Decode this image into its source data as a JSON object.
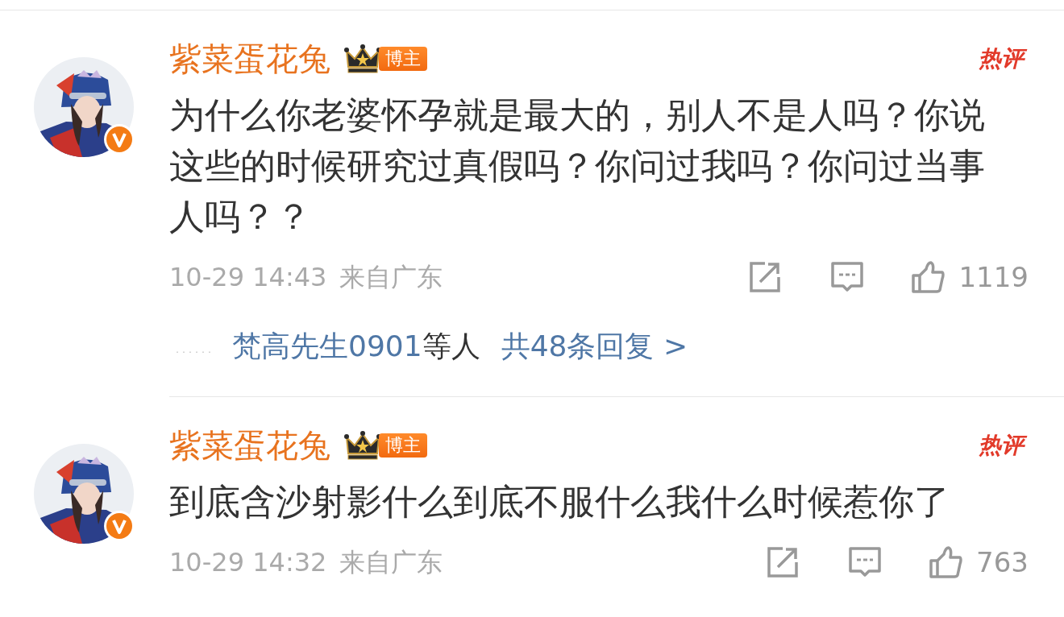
{
  "comments": [
    {
      "author": "紫菜蛋花兔",
      "badge": "博主",
      "hot_label": "热评",
      "verified": true,
      "text": "为什么你老婆怀孕就是最大的，别人不是人吗？你说这些的时候研究过真假吗？你问过我吗？你问过当事人吗？？",
      "time": "10-29 14:43",
      "location": "来自广东",
      "likes": "1119",
      "replies": {
        "leader": "……",
        "names": "梵高先生0901",
        "suffix": "等人",
        "total": "共48条回复 >"
      }
    },
    {
      "author": "紫菜蛋花兔",
      "badge": "博主",
      "hot_label": "热评",
      "verified": true,
      "text": "到底含沙射影什么到底不服什么我什么时候惹你了",
      "time": "10-29 14:32",
      "location": "来自广东",
      "likes": "763"
    }
  ]
}
